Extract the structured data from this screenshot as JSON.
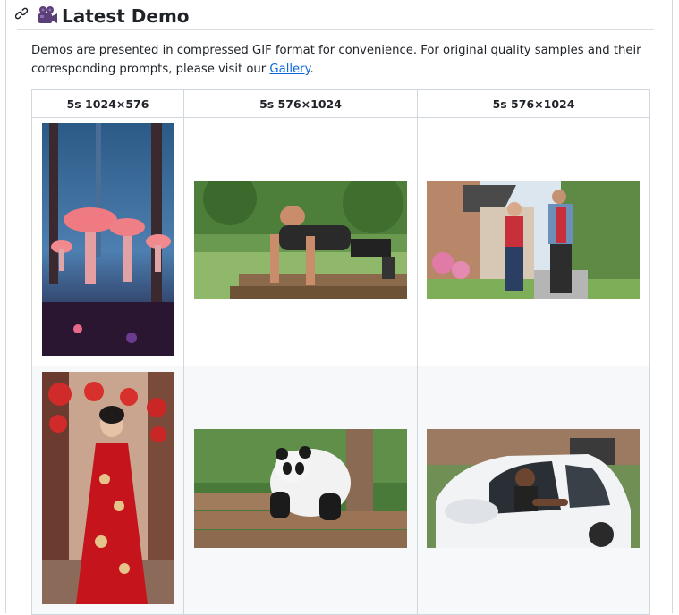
{
  "heading": {
    "title": "Latest Demo",
    "anchor_icon": "link-icon",
    "emoji_icon": "movie-camera-icon"
  },
  "description": {
    "text_before": "Demos are presented in compressed GIF format for convenience. For original quality samples and their corresponding prompts, please visit our ",
    "link_text": "Gallery",
    "text_after": "."
  },
  "table": {
    "headers": [
      "5s 1024×576",
      "5s 576×1024",
      "5s 576×1024"
    ],
    "rows": [
      [
        {
          "icon": "glowing-mushrooms-forest-image"
        },
        {
          "icon": "man-doing-pushups-image"
        },
        {
          "icon": "couple-jogging-street-image"
        }
      ],
      [
        {
          "icon": "woman-red-dress-lanterns-image"
        },
        {
          "icon": "panda-on-logs-image"
        },
        {
          "icon": "woman-in-car-image"
        }
      ]
    ]
  },
  "colors": {
    "link": "#0969da",
    "border": "#d0d7de",
    "row_alt": "#f6f8fa"
  }
}
